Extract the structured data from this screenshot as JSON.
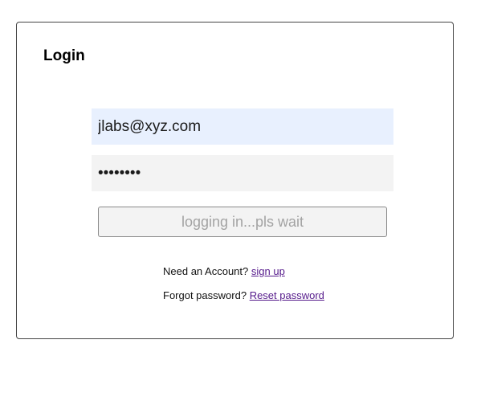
{
  "login": {
    "title": "Login",
    "email_value": "jlabs@xyz.com",
    "password_value": "••••••••",
    "submit_label": "logging in...pls wait",
    "signup_prompt": "Need an Account?",
    "signup_link": "sign up",
    "forgot_prompt": "Forgot password?",
    "reset_link": "Reset password"
  },
  "colors": {
    "email_bg": "#e8f0fe",
    "password_bg": "#f3f3f3",
    "link": "#551a8b",
    "disabled_text": "#a3a3a3"
  }
}
